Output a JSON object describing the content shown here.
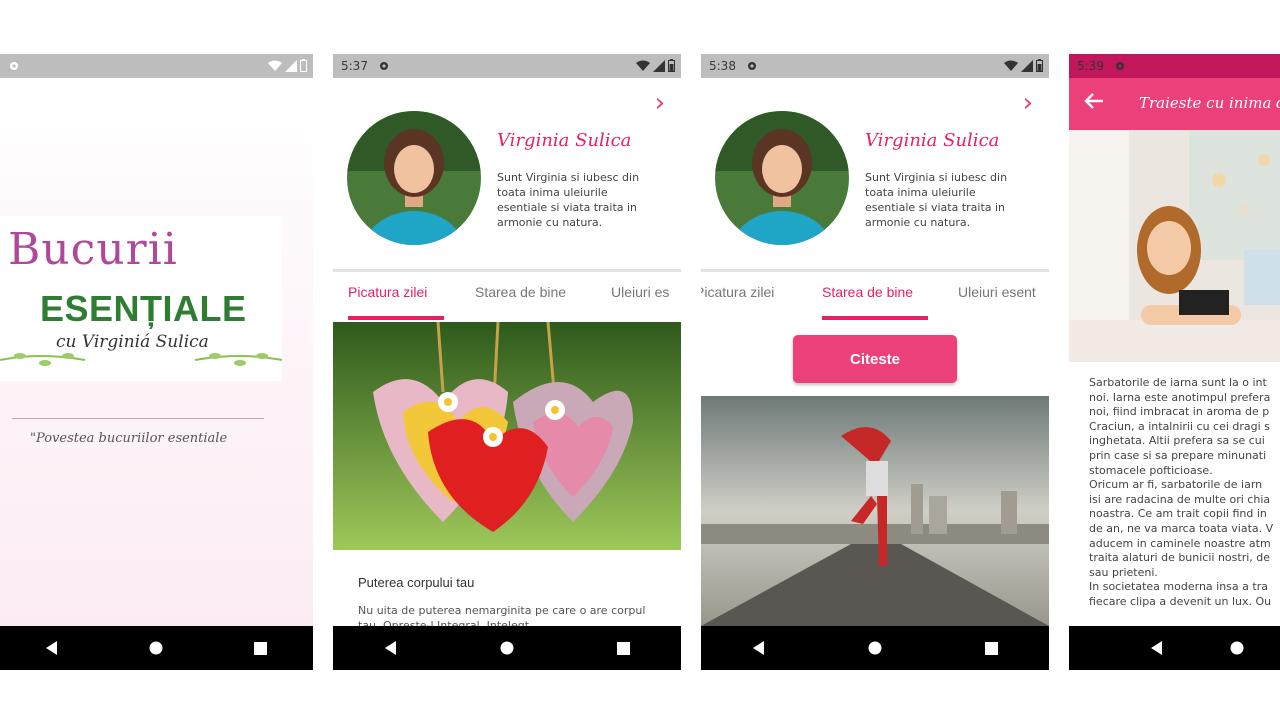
{
  "colors": {
    "accent": "#e91e63",
    "button": "#ec407a",
    "statusbar": "#bdbdbd",
    "navbar": "#000000"
  },
  "phone1": {
    "logo": {
      "line1": "Bucurii",
      "line2": "ESENȚIALE",
      "line3": "cu Virginiá Sulica"
    },
    "tagline": "\"Povestea bucuriilor esentiale"
  },
  "phone2": {
    "status_time": "5:37",
    "profile": {
      "name": "Virginia Sulica",
      "description": "Sunt Virginia si iubesc din toata inima uleiurile esentiale si viata traita in armonie cu natura."
    },
    "tabs": [
      "Picatura zilei",
      "Starea de bine",
      "Uleiuri es"
    ],
    "card": {
      "title": "Puterea corpului tau",
      "body": "Nu uita de puterea nemarginita pe care o are corpul tau. Opreste-l Integral. Intelegt"
    }
  },
  "phone3": {
    "status_time": "5:38",
    "profile": {
      "name": "Virginia Sulica",
      "description": "Sunt Virginia si iubesc din toata inima uleiurile esentiale si viata traita in armonie cu natura."
    },
    "tabs": [
      "Picatura zilei",
      "Starea de bine",
      "Uleiuri esent"
    ],
    "read_button": "Citeste"
  },
  "phone4": {
    "status_time": "5:39",
    "title": "Traieste cu inima d",
    "article_lines": [
      "Sarbatorile de iarna sunt la o int",
      "noi. Iarna este anotimpul prefera",
      "noi, fiind imbracat in aroma de p",
      "Craciun, a intalnirii cu cei dragi s",
      "inghetata. Altii prefera sa se cui",
      "prin case si sa prepare minunati",
      "stomacele pofticioase.",
      "Oricum ar fi, sarbatorile de iarn",
      "isi are radacina de multe ori chia",
      "noastra. Ce am trait copii find in",
      "de an, ne va marca toata viata. V",
      "aducem in caminele noastre atm",
      "traita alaturi de bunicii nostri, de",
      "sau prieteni.",
      "In societatea moderna insa a tra",
      "fiecare clipa a devenit un lux. Ou"
    ]
  }
}
